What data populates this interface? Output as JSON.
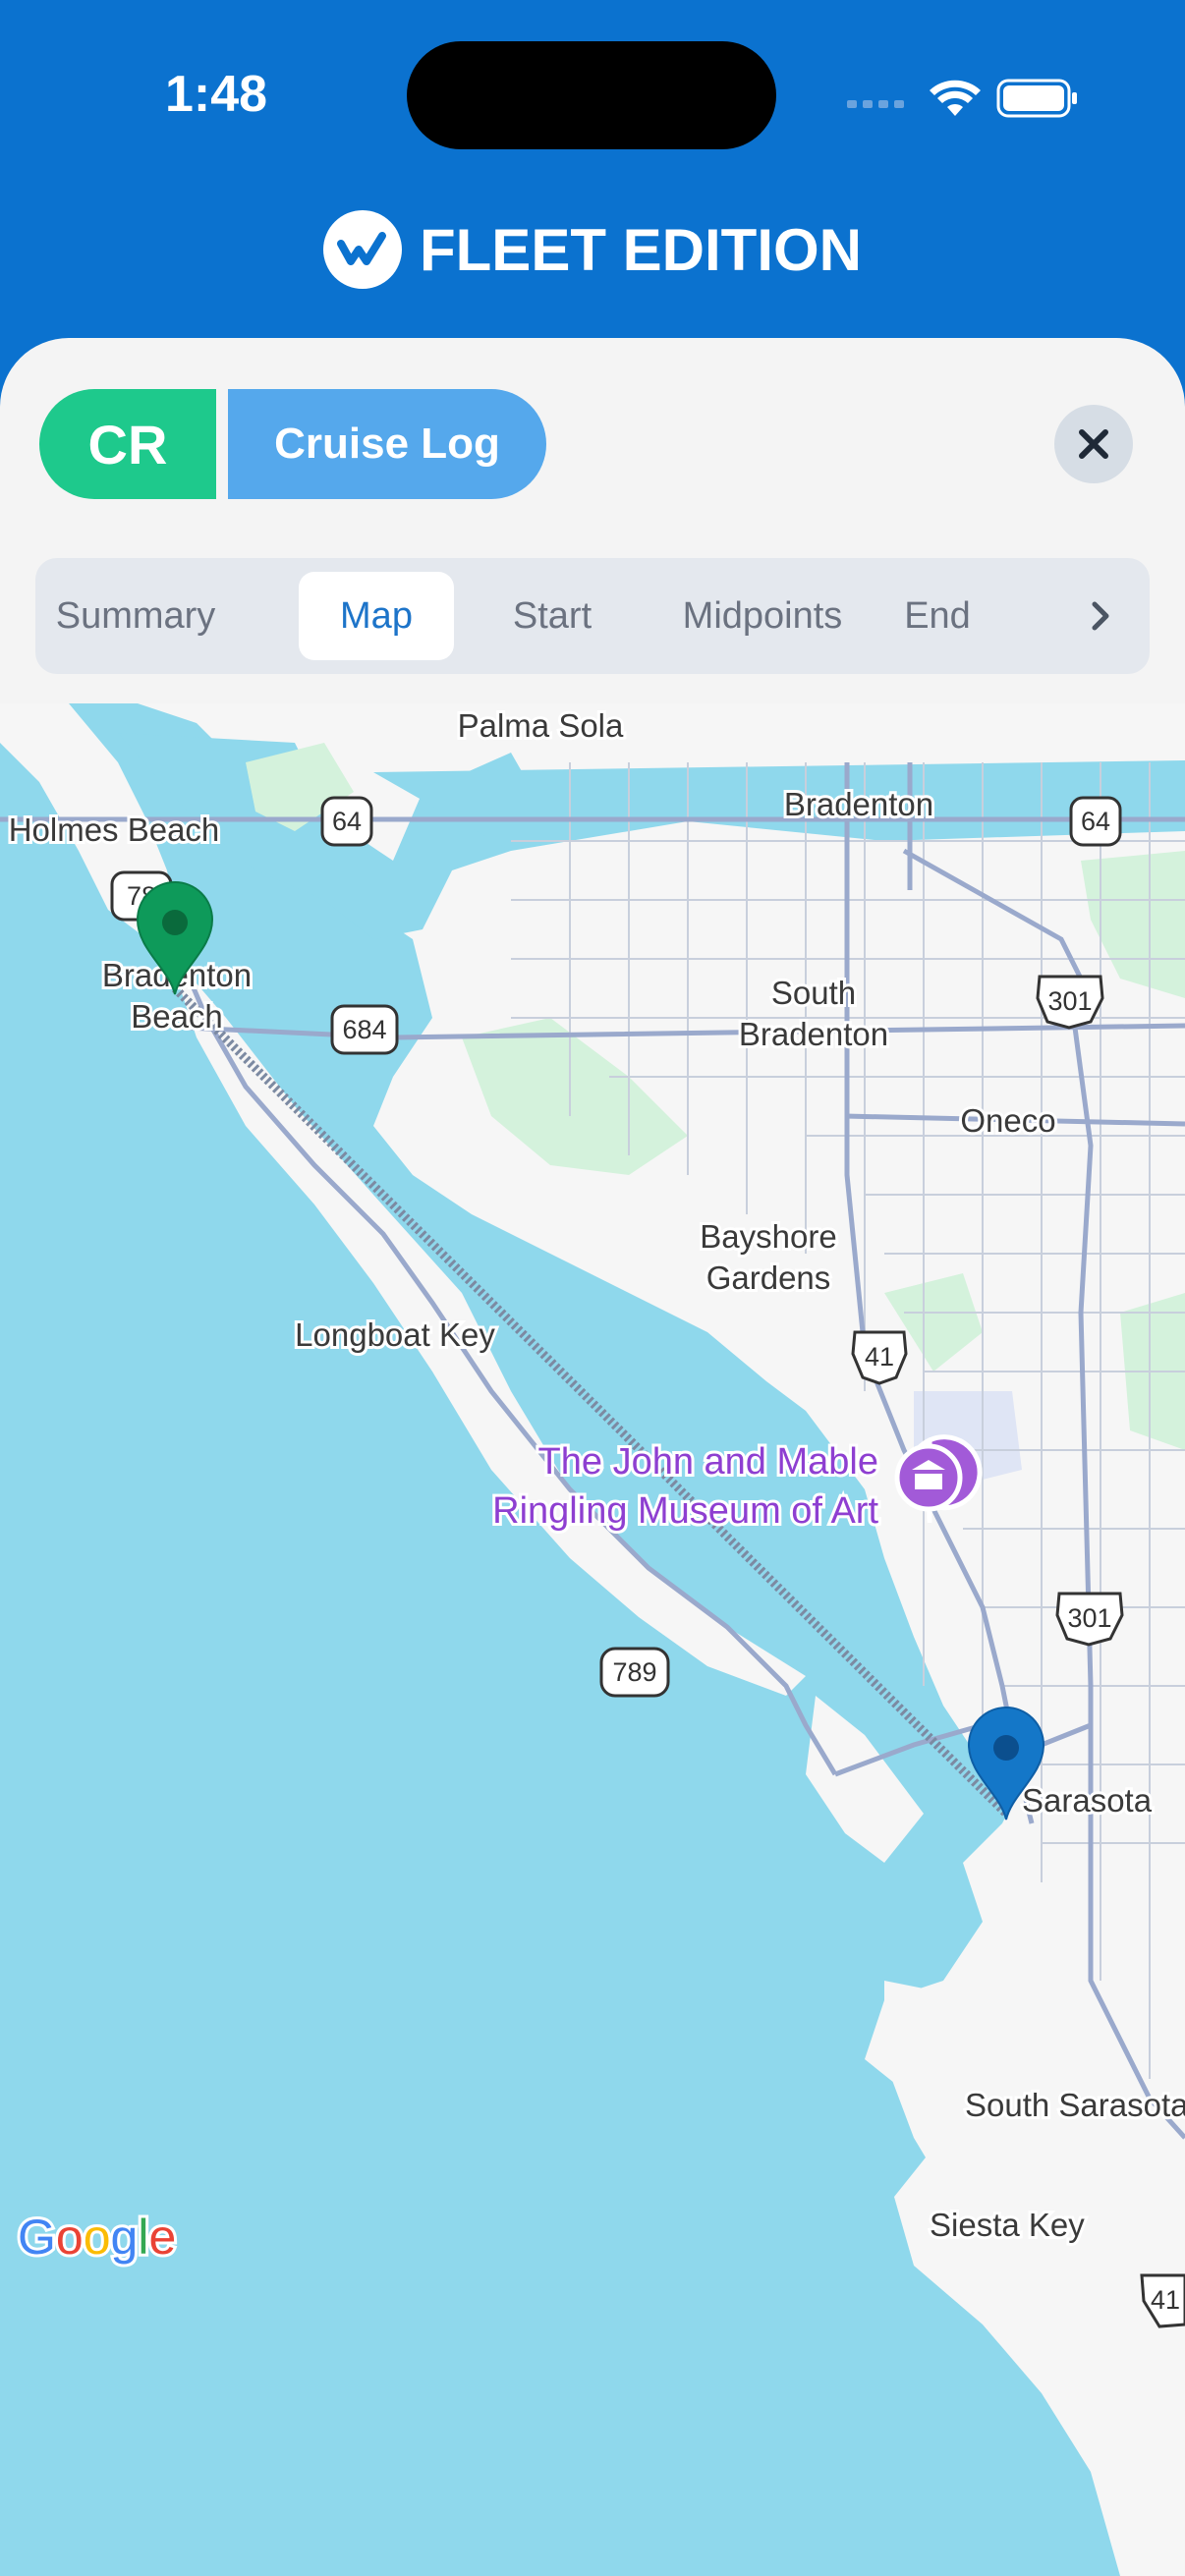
{
  "status_bar": {
    "time": "1:48"
  },
  "brand": {
    "name": "FLEET EDITION"
  },
  "header_pill": {
    "code": "CR",
    "title": "Cruise Log"
  },
  "tabs": [
    {
      "label": "Summary"
    },
    {
      "label": "Map"
    },
    {
      "label": "Start"
    },
    {
      "label": "Midpoints"
    },
    {
      "label": "End"
    }
  ],
  "active_tab": "Map",
  "map": {
    "places": {
      "palma_sola": "Palma Sola",
      "holmes_beach": "Holmes Beach",
      "bradenton": "Bradenton",
      "bradenton_beach_1": "Bradenton",
      "bradenton_beach_2": "Beach",
      "south_bradenton_1": "South",
      "south_bradenton_2": "Bradenton",
      "oneco": "Oneco",
      "bayshore_1": "Bayshore",
      "bayshore_2": "Gardens",
      "longboat_key": "Longboat Key",
      "sarasota": "Sarasota",
      "south_sarasota": "South Sarasota",
      "siesta_key": "Siesta Key"
    },
    "poi": {
      "line1": "The John and Mable",
      "line2": "Ringling Museum of Art"
    },
    "shields": {
      "r64a": "64",
      "r64b": "64",
      "r78": "78",
      "r684": "684",
      "r301a": "301",
      "r301b": "301",
      "r41a": "41",
      "r41b": "41",
      "r789": "789"
    },
    "attribution": "Google",
    "colors": {
      "water": "#8fd8ec",
      "land": "#f6f6f6",
      "green": "#d4f2dc",
      "road": "#9aa9cc",
      "start_marker": "#0e9a5a",
      "end_marker": "#1477c8"
    }
  }
}
